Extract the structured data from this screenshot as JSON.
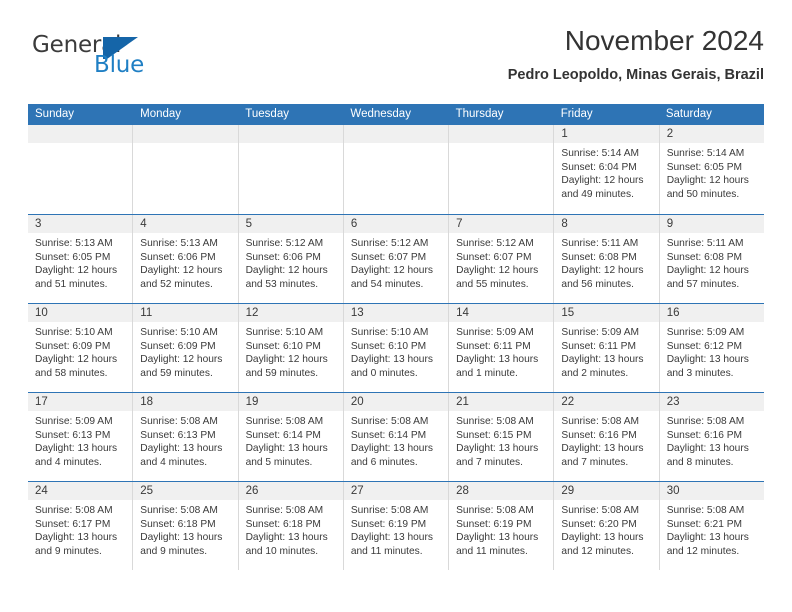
{
  "logo": {
    "word1": "General",
    "word2": "Blue",
    "mark": "blue-flag-triangle"
  },
  "header": {
    "title": "November 2024",
    "subtitle": "Pedro Leopoldo, Minas Gerais, Brazil"
  },
  "colors": {
    "header_blue": "#2e74b5",
    "daynum_band": "#f0f0f0",
    "logo_blue": "#1f7fc4",
    "text": "#333333"
  },
  "weekdays": [
    "Sunday",
    "Monday",
    "Tuesday",
    "Wednesday",
    "Thursday",
    "Friday",
    "Saturday"
  ],
  "weeks": [
    [
      {
        "day": "",
        "sunrise": "",
        "sunset": "",
        "daylight": ""
      },
      {
        "day": "",
        "sunrise": "",
        "sunset": "",
        "daylight": ""
      },
      {
        "day": "",
        "sunrise": "",
        "sunset": "",
        "daylight": ""
      },
      {
        "day": "",
        "sunrise": "",
        "sunset": "",
        "daylight": ""
      },
      {
        "day": "",
        "sunrise": "",
        "sunset": "",
        "daylight": ""
      },
      {
        "day": "1",
        "sunrise": "Sunrise: 5:14 AM",
        "sunset": "Sunset: 6:04 PM",
        "daylight": "Daylight: 12 hours and 49 minutes."
      },
      {
        "day": "2",
        "sunrise": "Sunrise: 5:14 AM",
        "sunset": "Sunset: 6:05 PM",
        "daylight": "Daylight: 12 hours and 50 minutes."
      }
    ],
    [
      {
        "day": "3",
        "sunrise": "Sunrise: 5:13 AM",
        "sunset": "Sunset: 6:05 PM",
        "daylight": "Daylight: 12 hours and 51 minutes."
      },
      {
        "day": "4",
        "sunrise": "Sunrise: 5:13 AM",
        "sunset": "Sunset: 6:06 PM",
        "daylight": "Daylight: 12 hours and 52 minutes."
      },
      {
        "day": "5",
        "sunrise": "Sunrise: 5:12 AM",
        "sunset": "Sunset: 6:06 PM",
        "daylight": "Daylight: 12 hours and 53 minutes."
      },
      {
        "day": "6",
        "sunrise": "Sunrise: 5:12 AM",
        "sunset": "Sunset: 6:07 PM",
        "daylight": "Daylight: 12 hours and 54 minutes."
      },
      {
        "day": "7",
        "sunrise": "Sunrise: 5:12 AM",
        "sunset": "Sunset: 6:07 PM",
        "daylight": "Daylight: 12 hours and 55 minutes."
      },
      {
        "day": "8",
        "sunrise": "Sunrise: 5:11 AM",
        "sunset": "Sunset: 6:08 PM",
        "daylight": "Daylight: 12 hours and 56 minutes."
      },
      {
        "day": "9",
        "sunrise": "Sunrise: 5:11 AM",
        "sunset": "Sunset: 6:08 PM",
        "daylight": "Daylight: 12 hours and 57 minutes."
      }
    ],
    [
      {
        "day": "10",
        "sunrise": "Sunrise: 5:10 AM",
        "sunset": "Sunset: 6:09 PM",
        "daylight": "Daylight: 12 hours and 58 minutes."
      },
      {
        "day": "11",
        "sunrise": "Sunrise: 5:10 AM",
        "sunset": "Sunset: 6:09 PM",
        "daylight": "Daylight: 12 hours and 59 minutes."
      },
      {
        "day": "12",
        "sunrise": "Sunrise: 5:10 AM",
        "sunset": "Sunset: 6:10 PM",
        "daylight": "Daylight: 12 hours and 59 minutes."
      },
      {
        "day": "13",
        "sunrise": "Sunrise: 5:10 AM",
        "sunset": "Sunset: 6:10 PM",
        "daylight": "Daylight: 13 hours and 0 minutes."
      },
      {
        "day": "14",
        "sunrise": "Sunrise: 5:09 AM",
        "sunset": "Sunset: 6:11 PM",
        "daylight": "Daylight: 13 hours and 1 minute."
      },
      {
        "day": "15",
        "sunrise": "Sunrise: 5:09 AM",
        "sunset": "Sunset: 6:11 PM",
        "daylight": "Daylight: 13 hours and 2 minutes."
      },
      {
        "day": "16",
        "sunrise": "Sunrise: 5:09 AM",
        "sunset": "Sunset: 6:12 PM",
        "daylight": "Daylight: 13 hours and 3 minutes."
      }
    ],
    [
      {
        "day": "17",
        "sunrise": "Sunrise: 5:09 AM",
        "sunset": "Sunset: 6:13 PM",
        "daylight": "Daylight: 13 hours and 4 minutes."
      },
      {
        "day": "18",
        "sunrise": "Sunrise: 5:08 AM",
        "sunset": "Sunset: 6:13 PM",
        "daylight": "Daylight: 13 hours and 4 minutes."
      },
      {
        "day": "19",
        "sunrise": "Sunrise: 5:08 AM",
        "sunset": "Sunset: 6:14 PM",
        "daylight": "Daylight: 13 hours and 5 minutes."
      },
      {
        "day": "20",
        "sunrise": "Sunrise: 5:08 AM",
        "sunset": "Sunset: 6:14 PM",
        "daylight": "Daylight: 13 hours and 6 minutes."
      },
      {
        "day": "21",
        "sunrise": "Sunrise: 5:08 AM",
        "sunset": "Sunset: 6:15 PM",
        "daylight": "Daylight: 13 hours and 7 minutes."
      },
      {
        "day": "22",
        "sunrise": "Sunrise: 5:08 AM",
        "sunset": "Sunset: 6:16 PM",
        "daylight": "Daylight: 13 hours and 7 minutes."
      },
      {
        "day": "23",
        "sunrise": "Sunrise: 5:08 AM",
        "sunset": "Sunset: 6:16 PM",
        "daylight": "Daylight: 13 hours and 8 minutes."
      }
    ],
    [
      {
        "day": "24",
        "sunrise": "Sunrise: 5:08 AM",
        "sunset": "Sunset: 6:17 PM",
        "daylight": "Daylight: 13 hours and 9 minutes."
      },
      {
        "day": "25",
        "sunrise": "Sunrise: 5:08 AM",
        "sunset": "Sunset: 6:18 PM",
        "daylight": "Daylight: 13 hours and 9 minutes."
      },
      {
        "day": "26",
        "sunrise": "Sunrise: 5:08 AM",
        "sunset": "Sunset: 6:18 PM",
        "daylight": "Daylight: 13 hours and 10 minutes."
      },
      {
        "day": "27",
        "sunrise": "Sunrise: 5:08 AM",
        "sunset": "Sunset: 6:19 PM",
        "daylight": "Daylight: 13 hours and 11 minutes."
      },
      {
        "day": "28",
        "sunrise": "Sunrise: 5:08 AM",
        "sunset": "Sunset: 6:19 PM",
        "daylight": "Daylight: 13 hours and 11 minutes."
      },
      {
        "day": "29",
        "sunrise": "Sunrise: 5:08 AM",
        "sunset": "Sunset: 6:20 PM",
        "daylight": "Daylight: 13 hours and 12 minutes."
      },
      {
        "day": "30",
        "sunrise": "Sunrise: 5:08 AM",
        "sunset": "Sunset: 6:21 PM",
        "daylight": "Daylight: 13 hours and 12 minutes."
      }
    ]
  ]
}
